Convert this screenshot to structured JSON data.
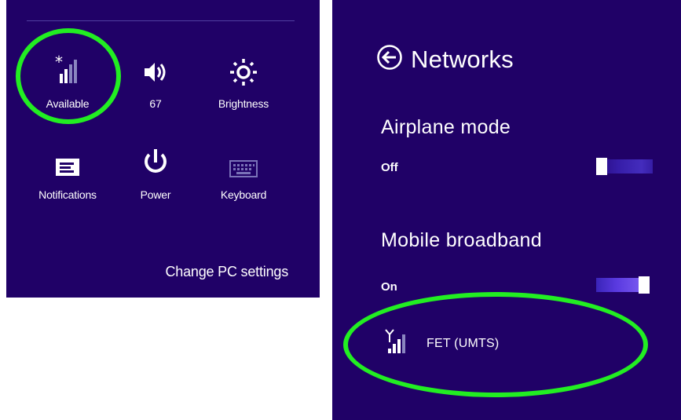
{
  "settings_panel": {
    "tiles": [
      {
        "label": "Available",
        "icon": "wireless-signal-available-icon"
      },
      {
        "label": "67",
        "icon": "volume-icon"
      },
      {
        "label": "Brightness",
        "icon": "brightness-icon"
      },
      {
        "label": "Notifications",
        "icon": "notifications-icon"
      },
      {
        "label": "Power",
        "icon": "power-icon"
      },
      {
        "label": "Keyboard",
        "icon": "keyboard-icon"
      }
    ],
    "change_pc_settings": "Change PC settings"
  },
  "networks_panel": {
    "title": "Networks",
    "airplane_mode": {
      "title": "Airplane mode",
      "state": "Off"
    },
    "mobile_broadband": {
      "title": "Mobile broadband",
      "state": "On"
    },
    "connection": {
      "name": "FET (UMTS)",
      "icon": "cellular-antenna-signal-icon"
    }
  },
  "colors": {
    "panel_background": "#200167",
    "highlight": "#22ee22",
    "text": "#ffffff"
  }
}
